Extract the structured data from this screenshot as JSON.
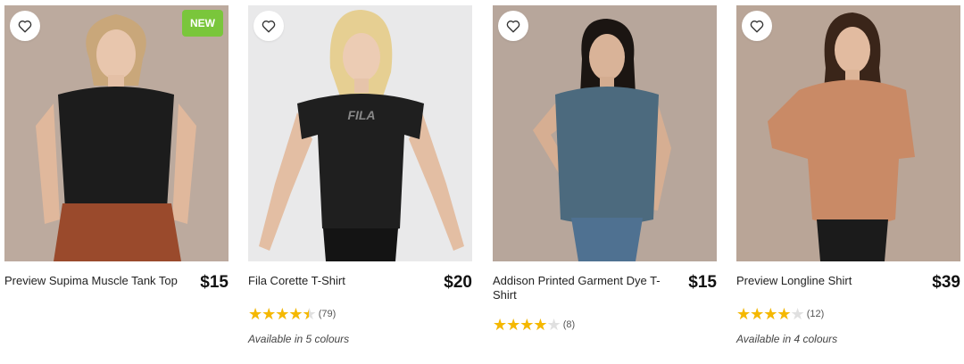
{
  "products": [
    {
      "name": "Preview Supima Muscle Tank Top",
      "price": "$15",
      "badge": "NEW",
      "image_bg": "#bcaa9e",
      "top_color": "#1c1c1c",
      "bottom_color": "#9a4a2c"
    },
    {
      "name": "Fila Corette T-Shirt",
      "price": "$20",
      "rating": 4.5,
      "review_count": "(79)",
      "availability": "Available in 5 colours",
      "image_bg": "#e9e9ea",
      "top_color": "#1f1f1f",
      "bottom_color": "#141414",
      "print_text": "FILA"
    },
    {
      "name": "Addison Printed Garment Dye T-Shirt",
      "price": "$15",
      "rating": 4,
      "review_count": "(8)",
      "image_bg": "#b7a69b",
      "top_color": "#4c6a7e",
      "bottom_color": "#4f7191"
    },
    {
      "name": "Preview Longline Shirt",
      "price": "$39",
      "rating": 4,
      "review_count": "(12)",
      "availability": "Available in 4 colours",
      "image_bg": "#b9a597",
      "top_color": "#c98a66",
      "bottom_color": "#1b1b1b"
    }
  ],
  "colors": {
    "badge": "#7ac63b",
    "star": "#f5b800",
    "star_empty": "#e0e0e0"
  },
  "icons": {
    "favourite": "heart-icon"
  }
}
